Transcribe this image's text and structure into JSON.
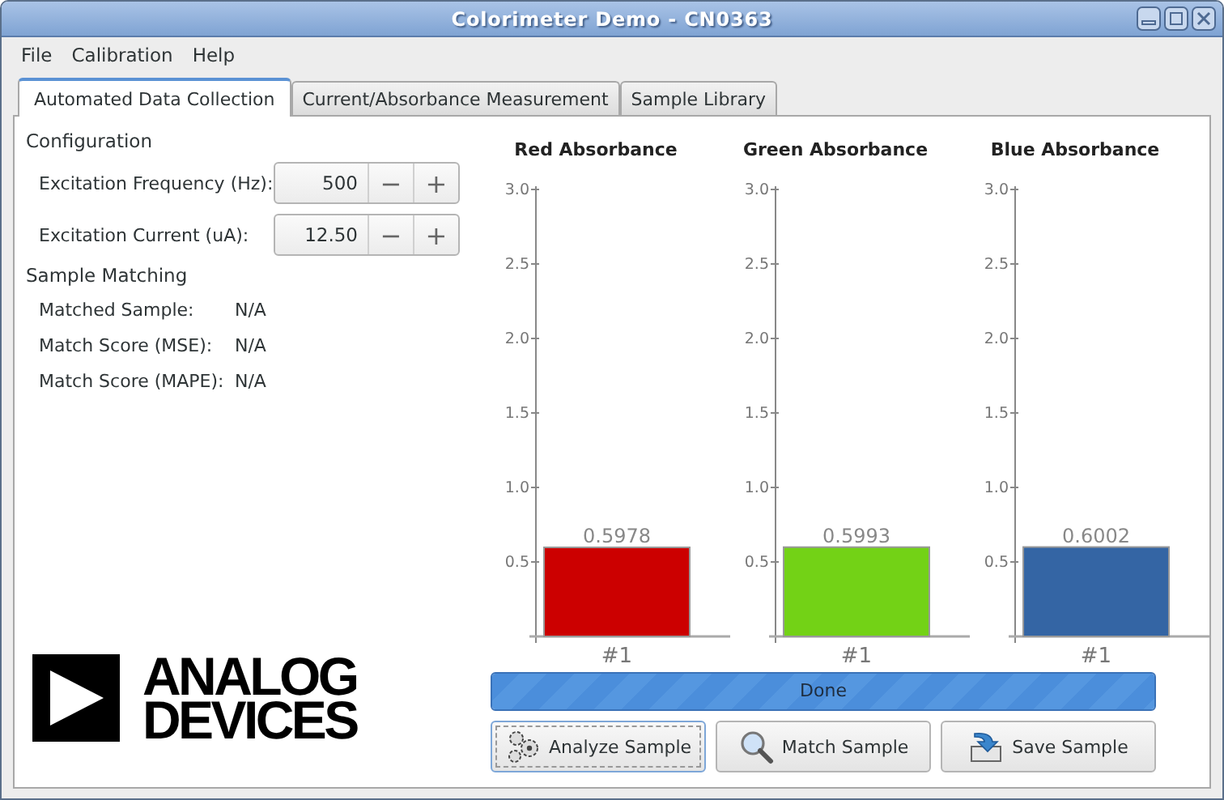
{
  "window": {
    "title": "Colorimeter Demo - CN0363"
  },
  "menu": [
    "File",
    "Calibration",
    "Help"
  ],
  "tabs": [
    {
      "label": "Automated Data Collection",
      "selected": true
    },
    {
      "label": "Current/Absorbance Measurement",
      "selected": false
    },
    {
      "label": "Sample Library",
      "selected": false
    }
  ],
  "configuration": {
    "title": "Configuration",
    "fields": [
      {
        "label": "Excitation Frequency (Hz):",
        "value": "500",
        "minus": "−",
        "plus": "+"
      },
      {
        "label": "Excitation Current (uA):",
        "value": "12.50",
        "minus": "−",
        "plus": "+"
      }
    ]
  },
  "sample_matching": {
    "title": "Sample Matching",
    "rows": [
      {
        "label": "Matched Sample:",
        "value": "N/A"
      },
      {
        "label": "Match Score (MSE):",
        "value": "N/A"
      },
      {
        "label": "Match Score (MAPE):",
        "value": "N/A"
      }
    ]
  },
  "logo": {
    "lines": [
      "ANALOG",
      "DEVICES"
    ]
  },
  "charts": [
    {
      "chart_data": {
        "type": "bar",
        "title": "Red Absorbance",
        "categories": [
          "#1"
        ],
        "series": [
          {
            "color": "#cc0000",
            "values": [
              0.5978
            ]
          }
        ],
        "ylim": [
          0,
          3.0
        ],
        "yticks": [
          {
            "value": 0.5,
            "label": "0.5"
          },
          {
            "value": 1,
            "label": "1.0"
          },
          {
            "value": 1.5,
            "label": "1.5"
          },
          {
            "value": 2,
            "label": "2.0"
          },
          {
            "value": 2.5,
            "label": "2.5"
          },
          {
            "value": 3,
            "label": "3.0"
          }
        ],
        "data_labels": true
      }
    },
    {
      "chart_data": {
        "type": "bar",
        "title": "Green Absorbance",
        "categories": [
          "#1"
        ],
        "series": [
          {
            "color": "#73d216",
            "values": [
              0.5993
            ]
          }
        ],
        "ylim": [
          0,
          3.0
        ],
        "yticks": [
          {
            "value": 0.5,
            "label": "0.5"
          },
          {
            "value": 1,
            "label": "1.0"
          },
          {
            "value": 1.5,
            "label": "1.5"
          },
          {
            "value": 2,
            "label": "2.0"
          },
          {
            "value": 2.5,
            "label": "2.5"
          },
          {
            "value": 3,
            "label": "3.0"
          }
        ],
        "data_labels": true
      }
    },
    {
      "chart_data": {
        "type": "bar",
        "title": "Blue Absorbance",
        "categories": [
          "#1"
        ],
        "series": [
          {
            "color": "#3465a4",
            "values": [
              0.6002
            ]
          }
        ],
        "ylim": [
          0,
          3.0
        ],
        "yticks": [
          {
            "value": 0.5,
            "label": "0.5"
          },
          {
            "value": 1,
            "label": "1.0"
          },
          {
            "value": 1.5,
            "label": "1.5"
          },
          {
            "value": 2,
            "label": "2.0"
          },
          {
            "value": 2.5,
            "label": "2.5"
          },
          {
            "value": 3,
            "label": "3.0"
          }
        ],
        "data_labels": true
      }
    }
  ],
  "progress": {
    "label": "Done",
    "level": 1
  },
  "buttons": [
    {
      "kind": "analyze",
      "label": "Analyze Sample",
      "focused": true
    },
    {
      "kind": "match",
      "label": "Match Sample",
      "focused": false
    },
    {
      "kind": "save",
      "label": "Save Sample",
      "focused": false
    }
  ]
}
